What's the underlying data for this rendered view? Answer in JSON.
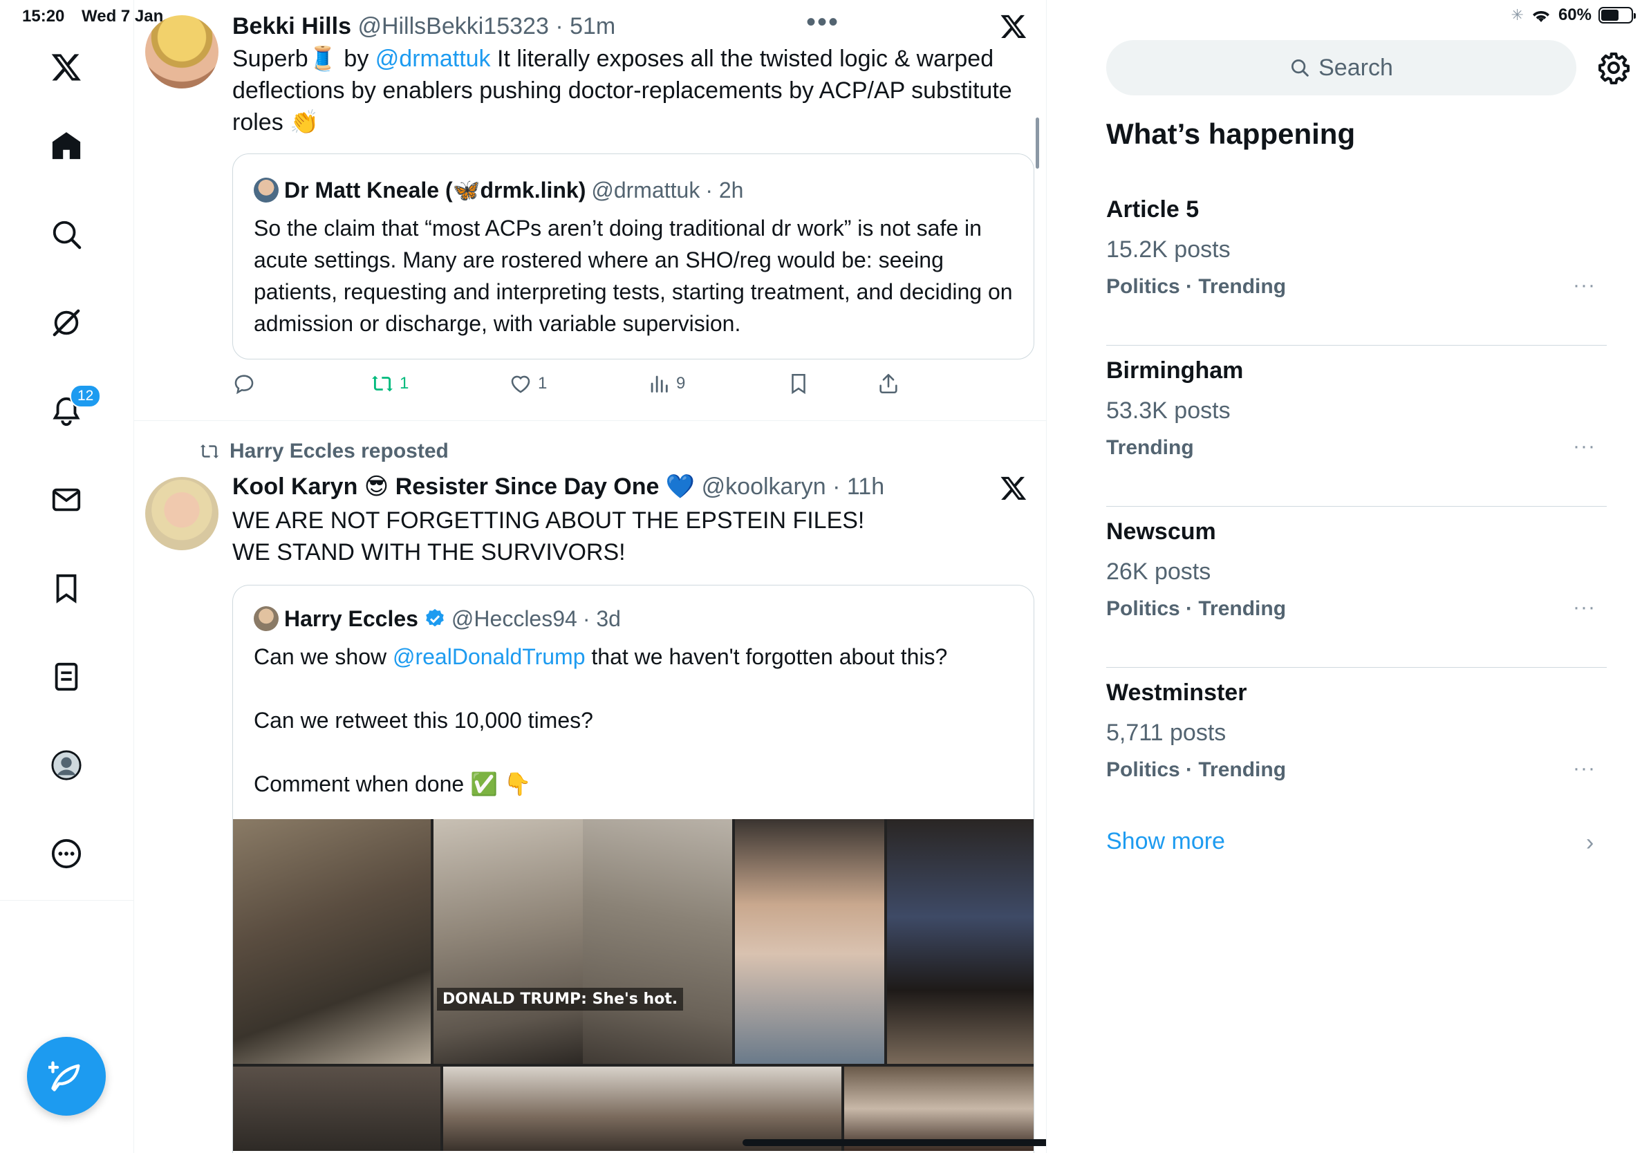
{
  "status_bar": {
    "time": "15:20",
    "date": "Wed 7 Jan",
    "battery": "60%",
    "battery_level": 0.6
  },
  "nav": {
    "notifications_badge": "12"
  },
  "tweets": [
    {
      "author": "Bekki Hills",
      "handle": "@HillsBekki15323",
      "time": "· 51m",
      "text_before_mention": "Superb🧵 by ",
      "mention": "@drmattuk",
      "text_after_mention": " It literally exposes all the twisted logic & warped deflections by enablers pushing doctor-replacements by ACP/AP substitute roles 👏",
      "quote": {
        "author": "Dr Matt Kneale (🦋drmk.link)",
        "handle": "@drmattuk",
        "time": "· 2h",
        "text": "So the claim that “most ACPs aren’t doing traditional dr work” is not safe in acute settings. Many are rostered where an SHO/reg would be: seeing patients, requesting and interpreting tests, starting treatment, and deciding on admission or discharge, with variable supervision."
      },
      "actions": {
        "replies": "",
        "reposts": "1",
        "likes": "1",
        "views": "9"
      }
    },
    {
      "repost_label": "Harry Eccles reposted",
      "author": "Kool Karyn 😎 Resister Since Day One 💙",
      "handle": "@koolkaryn",
      "time": "· 11h",
      "text_line1": "WE ARE NOT FORGETTING ABOUT THE EPSTEIN FILES!",
      "text_line2": "WE STAND WITH THE SURVIVORS!",
      "quote": {
        "author": "Harry Eccles",
        "handle": "@Heccles94",
        "time": "· 3d",
        "line1_before": "Can we show ",
        "line1_mention": "@realDonaldTrump",
        "line1_after": " that we haven't forgotten about this?",
        "line2": "Can we retweet this 10,000 times?",
        "line3": "Comment when done ✅ 👇",
        "image_caption": "DONALD TRUMP: She's hot."
      }
    }
  ],
  "sidebar": {
    "search_placeholder": "Search",
    "title": "What’s happening",
    "trends": [
      {
        "name": "Article 5",
        "posts": "15.2K posts",
        "category": "Politics · Trending"
      },
      {
        "name": "Birmingham",
        "posts": "53.3K posts",
        "category": "Trending"
      },
      {
        "name": "Newscum",
        "posts": "26K posts",
        "category": "Politics · Trending"
      },
      {
        "name": "Westminster",
        "posts": "5,711 posts",
        "category": "Politics · Trending"
      }
    ],
    "more_icon": "···",
    "show_more": "Show more"
  },
  "colors": {
    "accent": "#1d9bf0",
    "repost_green": "#00ba7c",
    "muted": "#536471"
  }
}
